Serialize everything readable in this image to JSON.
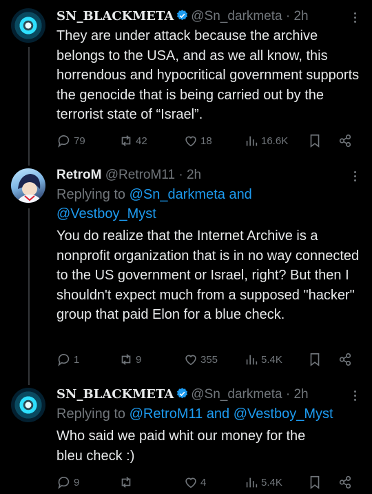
{
  "tweets": [
    {
      "name": "SN_BLACKMETA",
      "handle": "@Sn_darkmeta",
      "separator": "·",
      "time": "2h",
      "replying_prefix": "",
      "replying_to": "",
      "body": "They are under attack because the archive belongs to the USA, and as we all know, this horrendous and hypocritical government supports the genocide that is being carried out by the terrorist state of “Israel”.",
      "replies": "79",
      "reposts": "42",
      "likes": "18",
      "views": "16.6K"
    },
    {
      "name": "RetroM",
      "handle": "@RetroM11",
      "separator": "·",
      "time": "2h",
      "replying_prefix": "Replying to ",
      "replying_to": "@Sn_darkmeta and",
      "replying_to_2": "@Vestboy_Myst",
      "body": "You do realize that the Internet Archive is a nonprofit organization that is in no way connected to the US government or Israel, right? But then I shouldn't expect much from a supposed \"hacker\" group that paid Elon for a blue check.",
      "replies": "1",
      "reposts": "9",
      "likes": "355",
      "views": "5.4K"
    },
    {
      "name": "SN_BLACKMETA",
      "handle": "@Sn_darkmeta",
      "separator": "·",
      "time": "2h",
      "replying_prefix": "Replying to ",
      "replying_to": "@RetroM11 and @Vestboy_Myst",
      "body": "Who said we paid whit our money for the bleu check :)",
      "replies": "9",
      "reposts": "",
      "likes": "4",
      "views": "5.4K"
    }
  ],
  "colors": {
    "background": "#000000",
    "text": "#e7e9ea",
    "muted": "#71767b",
    "link": "#1d9bf0",
    "verified": "#1d9bf0"
  },
  "icons": [
    "reply-icon",
    "repost-icon",
    "like-icon",
    "views-icon",
    "bookmark-icon",
    "share-icon",
    "verified-badge-icon",
    "more-options-icon"
  ]
}
